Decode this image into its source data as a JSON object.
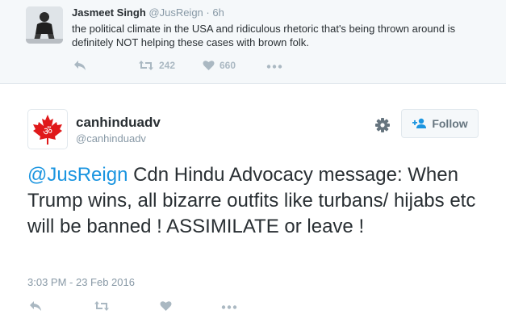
{
  "parent_tweet": {
    "author_name": "Jasmeet Singh",
    "author_handle": "@JusReign",
    "separator": "·",
    "time": "6h",
    "text": "the political climate in the USA and ridiculous rhetoric that's being thrown around is definitely NOT helping these cases with brown folk.",
    "retweet_count": "242",
    "like_count": "660"
  },
  "main_tweet": {
    "author_name": "canhinduadv",
    "author_handle": "@canhinduadv",
    "follow_label": "Follow",
    "mention": "@JusReign",
    "text": " Cdn Hindu Advocacy message: When Trump wins, all bizarre outfits like turbans/ hijabs etc will be banned ! ASSIMILATE or leave !",
    "timestamp": "3:03 PM - 23 Feb 2016"
  },
  "colors": {
    "link_blue": "#1b95e0",
    "muted_gray": "#8899a6",
    "icon_gray": "#aab8c2",
    "parent_background": "#f5f8fa",
    "maple_red": "#e0191a"
  },
  "icons": {
    "reply": "reply-icon",
    "retweet": "retweet-icon",
    "like": "heart-icon",
    "more": "more-icon",
    "settings": "gear-icon",
    "follow": "add-user-icon",
    "avatar_logo": "maple-leaf-om-logo"
  }
}
